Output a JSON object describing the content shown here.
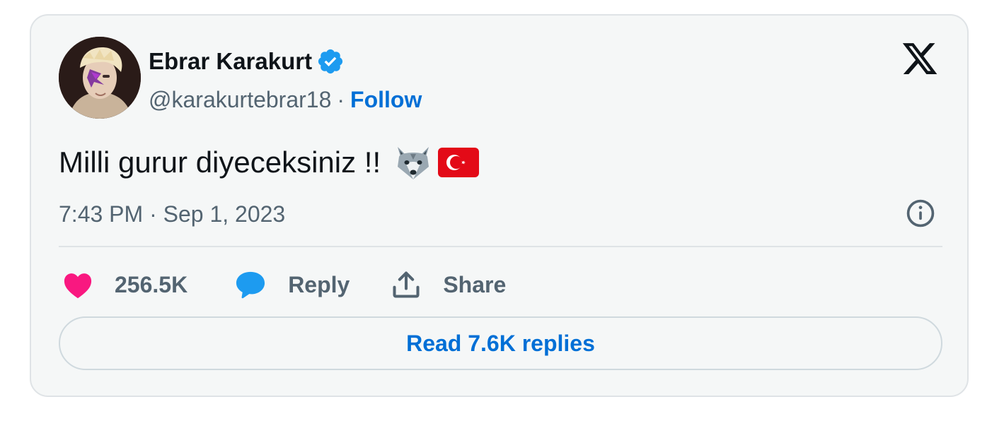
{
  "author": {
    "display_name": "Ebrar Karakurt",
    "handle": "@karakurtebrar18",
    "separator": "·",
    "follow_label": "Follow",
    "verified_icon": "verified-badge-icon"
  },
  "tweet": {
    "text": "Milli gurur diyeceksiniz !!",
    "emojis": [
      "wolf-emoji",
      "turkey-flag-emoji"
    ],
    "timestamp": "7:43 PM · Sep 1, 2023"
  },
  "actions": {
    "like_count": "256.5K",
    "reply_label": "Reply",
    "share_label": "Share"
  },
  "read_replies_label": "Read 7.6K replies",
  "colors": {
    "accent": "#006fd6",
    "verified": "#1d9bf0",
    "like": "#f91880",
    "text": "#0f1419",
    "muted": "#536471",
    "border": "#dfe3e6",
    "background": "#f5f7f7"
  }
}
